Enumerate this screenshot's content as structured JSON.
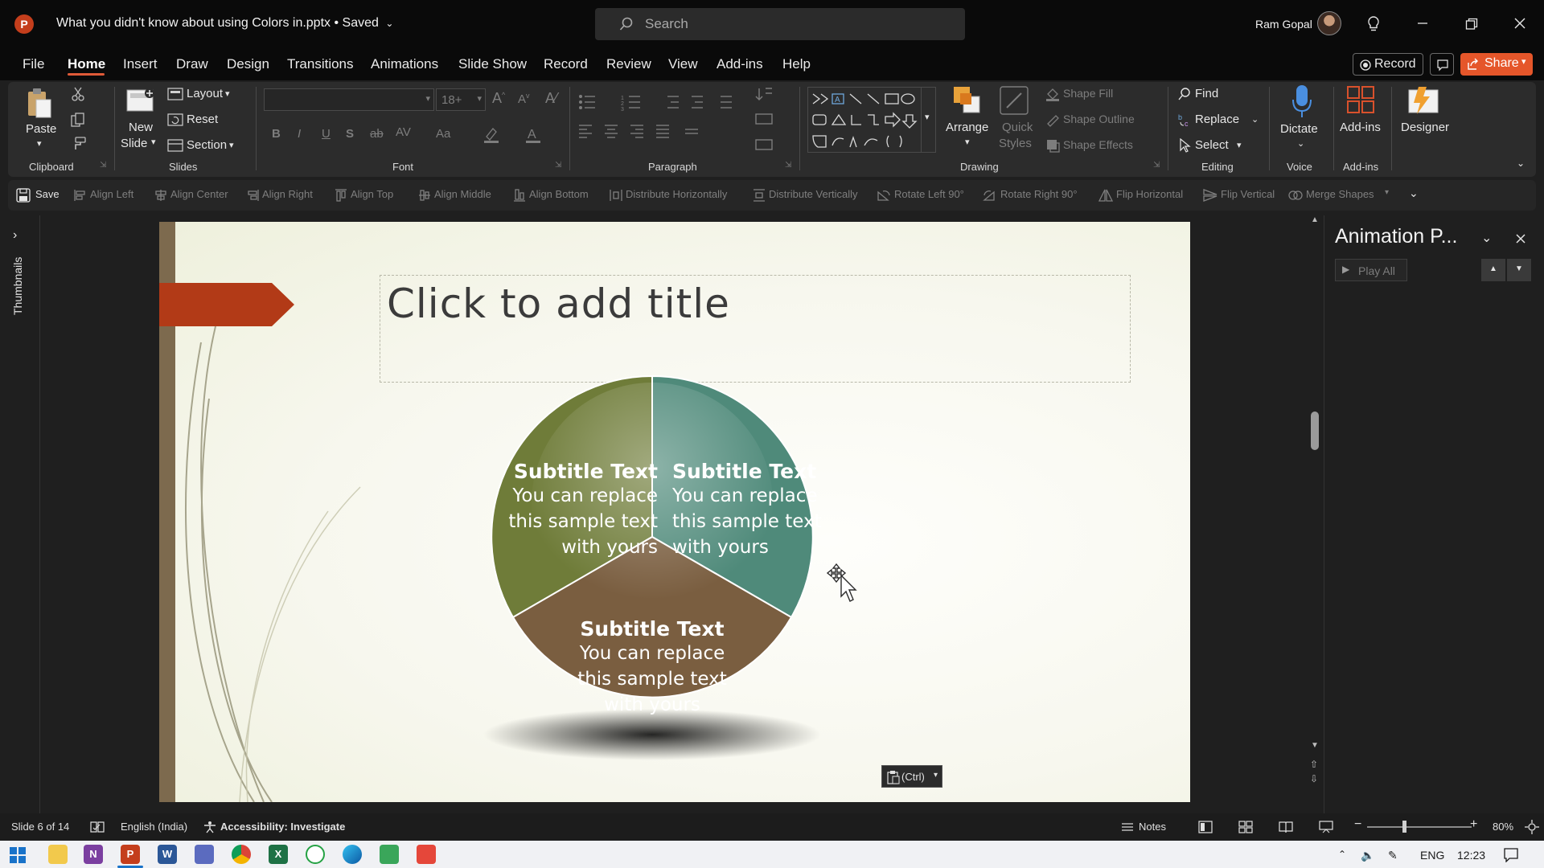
{
  "app": {
    "icon_letter": "P",
    "document_title": "What you didn't know about using Colors in.pptx • Saved",
    "search_placeholder": "Search",
    "user_name": "Ram Gopal"
  },
  "menu_tabs": [
    "File",
    "Home",
    "Insert",
    "Draw",
    "Design",
    "Transitions",
    "Animations",
    "Slide Show",
    "Record",
    "Review",
    "View",
    "Add-ins",
    "Help"
  ],
  "active_tab": "Home",
  "header_buttons": {
    "record": "Record",
    "share": "Share"
  },
  "ribbon": {
    "clipboard": {
      "paste": "Paste",
      "label": "Clipboard"
    },
    "slides": {
      "new_slide": "New",
      "new_slide2": "Slide",
      "layout": "Layout",
      "reset": "Reset",
      "section": "Section",
      "label": "Slides"
    },
    "font": {
      "size": "18+",
      "label": "Font",
      "bold": "B",
      "italic": "I",
      "underline": "U",
      "shadow": "S",
      "strike": "ab",
      "spacing": "AV",
      "case": "Aa"
    },
    "paragraph": {
      "label": "Paragraph"
    },
    "drawing": {
      "arrange": "Arrange",
      "quick_styles": "Quick",
      "quick_styles2": "Styles",
      "shape_fill": "Shape Fill",
      "shape_outline": "Shape Outline",
      "shape_effects": "Shape Effects",
      "label": "Drawing"
    },
    "editing": {
      "find": "Find",
      "replace": "Replace",
      "select": "Select",
      "label": "Editing"
    },
    "voice": {
      "dictate": "Dictate",
      "label": "Voice"
    },
    "addins": {
      "addins": "Add-ins",
      "label": "Add-ins"
    },
    "designer": {
      "designer": "Designer"
    }
  },
  "quick_toolbar": [
    "Save",
    "Align Left",
    "Align Center",
    "Align Right",
    "Align Top",
    "Align Middle",
    "Align Bottom",
    "Distribute Horizontally",
    "Distribute Vertically",
    "Rotate Left 90°",
    "Rotate Right 90°",
    "Flip Horizontal",
    "Flip Vertical",
    "Merge Shapes"
  ],
  "thumbnails_label": "Thumbnails",
  "slide": {
    "title_placeholder": "Click to add title",
    "segments": [
      {
        "title": "Subtitle Text",
        "line1": "You can replace",
        "line2": "this sample text",
        "line3": "with yours",
        "color": "#6f7c39"
      },
      {
        "title": "Subtitle Text",
        "line1": "You can replace",
        "line2": "this sample text",
        "line3": "with yours",
        "color": "#4f8a7a"
      },
      {
        "title": "Subtitle Text",
        "line1": "You can replace",
        "line2": "this sample text",
        "line3": "with yours",
        "color": "#7a5e40"
      }
    ],
    "accent_arrow_color": "#b23a17"
  },
  "paste_options": "(Ctrl)",
  "animation_pane": {
    "title": "Animation P...",
    "play_all": "Play All"
  },
  "status": {
    "slide_info": "Slide 6 of 14",
    "language": "English (India)",
    "accessibility": "Accessibility: Investigate",
    "notes": "Notes",
    "zoom": "80%"
  },
  "taskbar": {
    "lang": "ENG",
    "time": "12:23"
  }
}
